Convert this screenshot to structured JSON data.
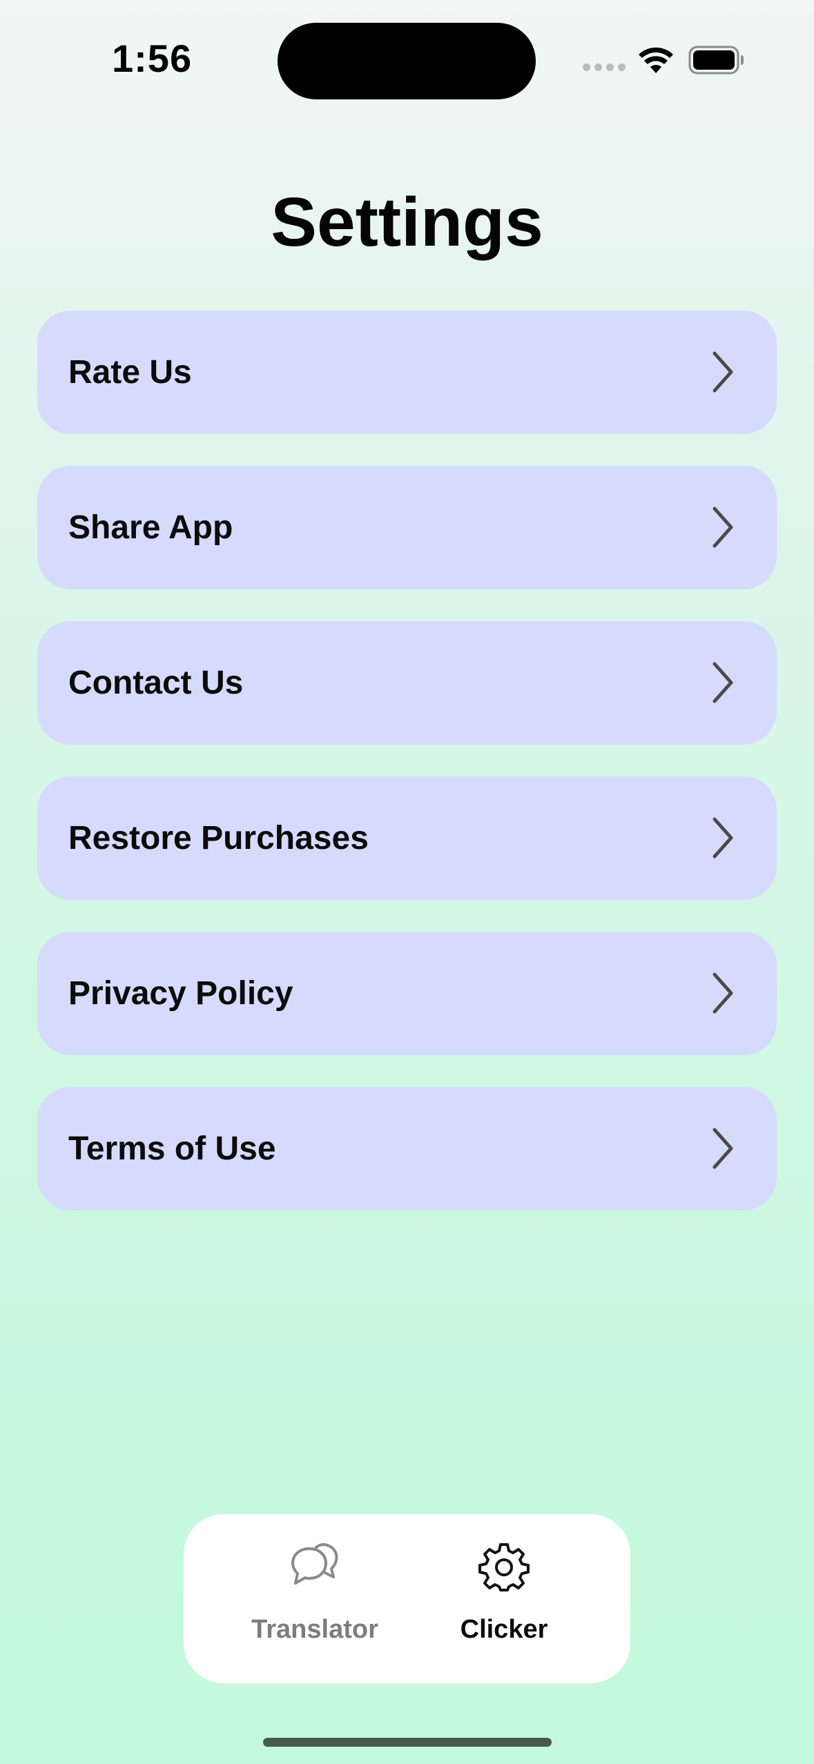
{
  "status_bar": {
    "time": "1:56",
    "icons": [
      "cellular-signal-icon",
      "wifi-icon",
      "battery-icon"
    ]
  },
  "header": {
    "title": "Settings"
  },
  "menu": {
    "items": [
      {
        "label": "Rate Us",
        "icon": "chevron-right-icon"
      },
      {
        "label": "Share App",
        "icon": "chevron-right-icon"
      },
      {
        "label": "Contact Us",
        "icon": "chevron-right-icon"
      },
      {
        "label": "Restore Purchases",
        "icon": "chevron-right-icon"
      },
      {
        "label": "Privacy Policy",
        "icon": "chevron-right-icon"
      },
      {
        "label": "Terms of Use",
        "icon": "chevron-right-icon"
      }
    ]
  },
  "tab_bar": {
    "tabs": [
      {
        "label": "Translator",
        "icon": "chat-bubbles-icon",
        "selected": false
      },
      {
        "label": "Clicker",
        "icon": "gear-icon",
        "selected": true
      }
    ]
  },
  "colors": {
    "menu_item_background": "#d6dbfd",
    "background_top": "#f2f6f5",
    "background_bottom": "#c3f9dc",
    "tab_inactive": "#7d7d7d",
    "tab_active": "#0c0c0c"
  }
}
